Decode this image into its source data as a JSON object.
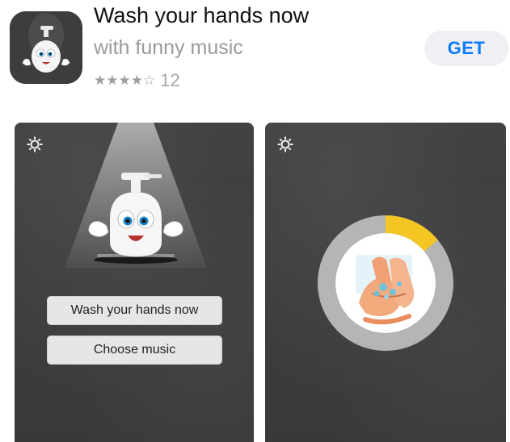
{
  "app": {
    "title": "Wash your hands now",
    "subtitle": "with funny music",
    "stars": "★★★★☆",
    "rating_value": 4,
    "rating_count": "12",
    "get_label": "GET",
    "icon": "soap-mascot-icon"
  },
  "screenshots": [
    {
      "settings_icon": "gear-icon",
      "buttons": {
        "wash_label": "Wash your hands now",
        "music_label": "Choose music"
      }
    },
    {
      "settings_icon": "gear-icon",
      "timer_progress": 0.14
    }
  ],
  "colors": {
    "accent": "#0a7aff",
    "get_bg": "#efeff4",
    "screenshot_bg": "#3c3c3c",
    "timer_track": "#b5b5b5",
    "timer_progress": "#f3c623"
  }
}
